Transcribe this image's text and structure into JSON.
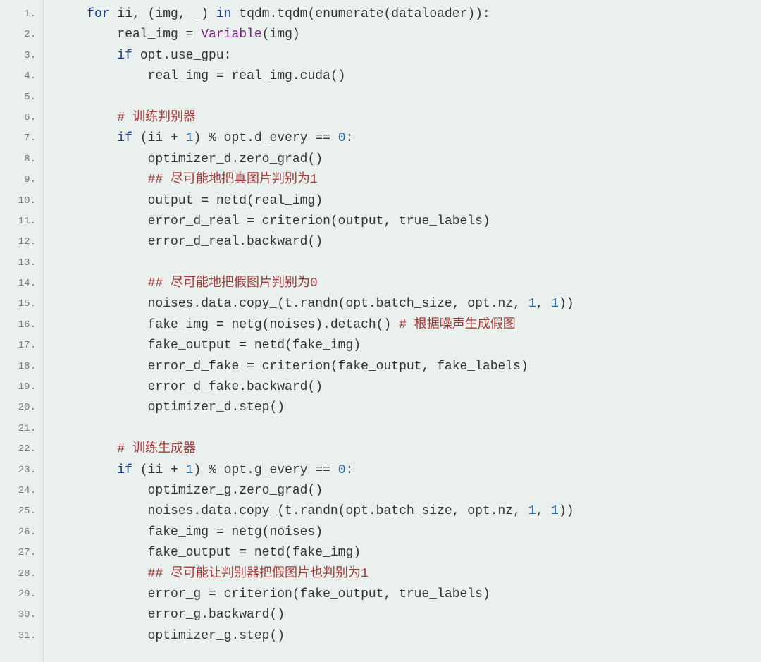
{
  "lines": [
    {
      "num": "1.",
      "indent": 1,
      "segments": [
        {
          "cls": "tok-keyword",
          "text": "for"
        },
        {
          "cls": "",
          "text": " ii, (img, _) "
        },
        {
          "cls": "tok-keyword",
          "text": "in"
        },
        {
          "cls": "",
          "text": " tqdm.tqdm(enumerate(dataloader)):"
        }
      ]
    },
    {
      "num": "2.",
      "indent": 2,
      "segments": [
        {
          "cls": "",
          "text": "real_img = "
        },
        {
          "cls": "tok-class",
          "text": "Variable"
        },
        {
          "cls": "",
          "text": "(img)"
        }
      ]
    },
    {
      "num": "3.",
      "indent": 2,
      "segments": [
        {
          "cls": "tok-keyword",
          "text": "if"
        },
        {
          "cls": "",
          "text": " opt.use_gpu:"
        }
      ]
    },
    {
      "num": "4.",
      "indent": 3,
      "segments": [
        {
          "cls": "",
          "text": "real_img = real_img.cuda()"
        }
      ]
    },
    {
      "num": "5.",
      "indent": 0,
      "segments": []
    },
    {
      "num": "6.",
      "indent": 2,
      "segments": [
        {
          "cls": "tok-comment",
          "text": "# 训练判别器"
        }
      ]
    },
    {
      "num": "7.",
      "indent": 2,
      "segments": [
        {
          "cls": "tok-keyword",
          "text": "if"
        },
        {
          "cls": "",
          "text": " (ii + "
        },
        {
          "cls": "tok-num",
          "text": "1"
        },
        {
          "cls": "",
          "text": ") % opt.d_every == "
        },
        {
          "cls": "tok-num",
          "text": "0"
        },
        {
          "cls": "",
          "text": ":"
        }
      ]
    },
    {
      "num": "8.",
      "indent": 3,
      "segments": [
        {
          "cls": "",
          "text": "optimizer_d.zero_grad()"
        }
      ]
    },
    {
      "num": "9.",
      "indent": 3,
      "segments": [
        {
          "cls": "tok-comment",
          "text": "## 尽可能地把真图片判别为1"
        }
      ]
    },
    {
      "num": "10.",
      "indent": 3,
      "segments": [
        {
          "cls": "",
          "text": "output = netd(real_img)"
        }
      ]
    },
    {
      "num": "11.",
      "indent": 3,
      "segments": [
        {
          "cls": "",
          "text": "error_d_real = criterion(output, true_labels)"
        }
      ]
    },
    {
      "num": "12.",
      "indent": 3,
      "segments": [
        {
          "cls": "",
          "text": "error_d_real.backward()"
        }
      ]
    },
    {
      "num": "13.",
      "indent": 0,
      "segments": []
    },
    {
      "num": "14.",
      "indent": 3,
      "segments": [
        {
          "cls": "tok-comment",
          "text": "## 尽可能地把假图片判别为0"
        }
      ]
    },
    {
      "num": "15.",
      "indent": 3,
      "segments": [
        {
          "cls": "",
          "text": "noises.data.copy_(t.randn(opt.batch_size, opt.nz, "
        },
        {
          "cls": "tok-num",
          "text": "1"
        },
        {
          "cls": "",
          "text": ", "
        },
        {
          "cls": "tok-num",
          "text": "1"
        },
        {
          "cls": "",
          "text": "))"
        }
      ]
    },
    {
      "num": "16.",
      "indent": 3,
      "segments": [
        {
          "cls": "",
          "text": "fake_img = netg(noises).detach() "
        },
        {
          "cls": "tok-comment",
          "text": "# 根据噪声生成假图"
        }
      ]
    },
    {
      "num": "17.",
      "indent": 3,
      "segments": [
        {
          "cls": "",
          "text": "fake_output = netd(fake_img)"
        }
      ]
    },
    {
      "num": "18.",
      "indent": 3,
      "segments": [
        {
          "cls": "",
          "text": "error_d_fake = criterion(fake_output, fake_labels)"
        }
      ]
    },
    {
      "num": "19.",
      "indent": 3,
      "segments": [
        {
          "cls": "",
          "text": "error_d_fake.backward()"
        }
      ]
    },
    {
      "num": "20.",
      "indent": 3,
      "segments": [
        {
          "cls": "",
          "text": "optimizer_d.step()"
        }
      ]
    },
    {
      "num": "21.",
      "indent": 0,
      "segments": []
    },
    {
      "num": "22.",
      "indent": 2,
      "segments": [
        {
          "cls": "tok-comment",
          "text": "# 训练生成器"
        }
      ]
    },
    {
      "num": "23.",
      "indent": 2,
      "segments": [
        {
          "cls": "tok-keyword",
          "text": "if"
        },
        {
          "cls": "",
          "text": " (ii + "
        },
        {
          "cls": "tok-num",
          "text": "1"
        },
        {
          "cls": "",
          "text": ") % opt.g_every == "
        },
        {
          "cls": "tok-num",
          "text": "0"
        },
        {
          "cls": "",
          "text": ":"
        }
      ]
    },
    {
      "num": "24.",
      "indent": 3,
      "segments": [
        {
          "cls": "",
          "text": "optimizer_g.zero_grad()"
        }
      ]
    },
    {
      "num": "25.",
      "indent": 3,
      "segments": [
        {
          "cls": "",
          "text": "noises.data.copy_(t.randn(opt.batch_size, opt.nz, "
        },
        {
          "cls": "tok-num",
          "text": "1"
        },
        {
          "cls": "",
          "text": ", "
        },
        {
          "cls": "tok-num",
          "text": "1"
        },
        {
          "cls": "",
          "text": "))"
        }
      ]
    },
    {
      "num": "26.",
      "indent": 3,
      "segments": [
        {
          "cls": "",
          "text": "fake_img = netg(noises)"
        }
      ]
    },
    {
      "num": "27.",
      "indent": 3,
      "segments": [
        {
          "cls": "",
          "text": "fake_output = netd(fake_img)"
        }
      ]
    },
    {
      "num": "28.",
      "indent": 3,
      "segments": [
        {
          "cls": "tok-comment",
          "text": "## 尽可能让判别器把假图片也判别为1"
        }
      ]
    },
    {
      "num": "29.",
      "indent": 3,
      "segments": [
        {
          "cls": "",
          "text": "error_g = criterion(fake_output, true_labels)"
        }
      ]
    },
    {
      "num": "30.",
      "indent": 3,
      "segments": [
        {
          "cls": "",
          "text": "error_g.backward()"
        }
      ]
    },
    {
      "num": "31.",
      "indent": 3,
      "segments": [
        {
          "cls": "",
          "text": "optimizer_g.step()"
        }
      ]
    }
  ]
}
